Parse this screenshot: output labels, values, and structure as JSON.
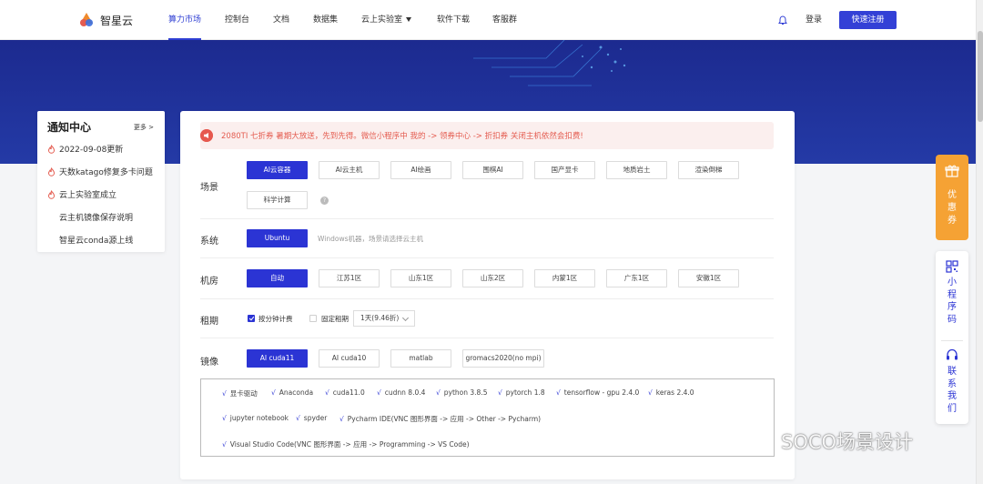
{
  "nav": {
    "brand": "智星云",
    "items": [
      {
        "label": "算力市场"
      },
      {
        "label": "控制台"
      },
      {
        "label": "文档"
      },
      {
        "label": "数据集"
      },
      {
        "label": "云上实验室"
      },
      {
        "label": "软件下载"
      },
      {
        "label": "客服群"
      }
    ],
    "login": "登录",
    "register": "快速注册"
  },
  "notice": {
    "title": "通知中心",
    "more": "更多 >",
    "items": [
      {
        "text": "2022-09-08更新"
      },
      {
        "text": "天数katago修复多卡问题"
      },
      {
        "text": "云上实验室成立"
      },
      {
        "text": "云主机镜像保存说明"
      },
      {
        "text": "智星云conda源上线"
      }
    ]
  },
  "promo": {
    "text": "2080TI 七折券 暑期大放送，先到先得。微信小程序中 我的 -> 领券中心 -> 折扣券 关闭主机依然会扣费!"
  },
  "scene": {
    "label": "场景",
    "options": [
      "AI云容器",
      "AI云主机",
      "AI绘画",
      "围棋AI",
      "国产显卡",
      "地质岩土",
      "渲染倒梯",
      "科学计算"
    ],
    "selected": "AI云容器",
    "hint_icon": "?"
  },
  "system": {
    "label": "系统",
    "options": [
      "Ubuntu"
    ],
    "selected": "Ubuntu",
    "note": "Windows机器，场景请选择云主机"
  },
  "room": {
    "label": "机房",
    "options": [
      "自动",
      "江苏1区",
      "山东1区",
      "山东2区",
      "内蒙1区",
      "广东1区",
      "安徽1区"
    ],
    "selected": "自动"
  },
  "rent": {
    "label": "租期",
    "by_minute": "按分钟计费",
    "by_minute_checked": true,
    "fixed": "固定租期",
    "fixed_checked": false,
    "duration": "1天(9.46折)"
  },
  "image": {
    "label": "镜像",
    "options": [
      "AI cuda11",
      "AI cuda10",
      "matlab",
      "gromacs2020(no mpi)"
    ],
    "selected": "AI cuda11",
    "software": [
      "显卡驱动",
      "Anaconda",
      "cuda11.0",
      "cudnn 8.0.4",
      "python 3.8.5",
      "pytorch 1.8",
      "tensorflow - gpu 2.4.0",
      "keras 2.4.0",
      "jupyter notebook",
      "spyder",
      "Pycharm IDE(VNC 图形界面 -> 应用 -> Other -> Pycharm)",
      "Visual Studio Code(VNC 图形界面 -> 应用 -> Programming -> VS Code)"
    ]
  },
  "float": {
    "coupon": "优\n惠\n券",
    "miniprogram": "小\n程\n序\n码",
    "contact": "联\n系\n我\n们"
  },
  "watermark": "SOCO场景设计",
  "colors": {
    "primary": "#2b34d4",
    "banner": "#1f2f9a",
    "promo_text": "#e45c50",
    "coupon": "#f5a234"
  }
}
